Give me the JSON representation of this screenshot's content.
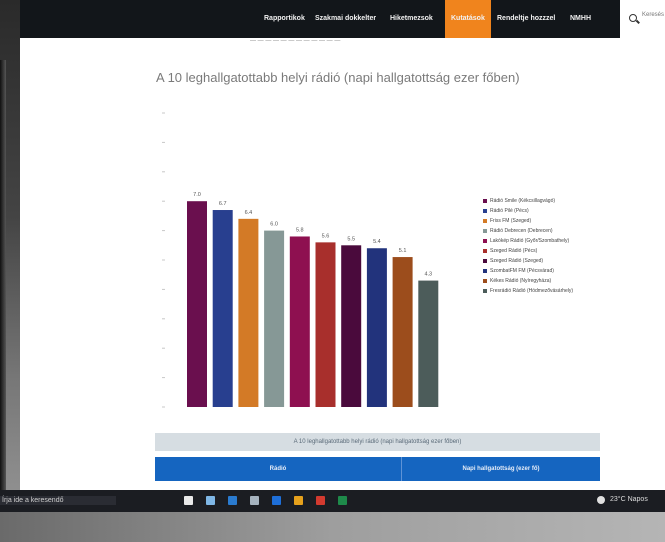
{
  "nav": {
    "items": [
      "Rapportikok",
      "Szakmai dokkelter",
      "Hiketmezsok",
      "Kutatások",
      "Rendeltje hozzzel",
      "NMHH"
    ],
    "active_index": 3,
    "search_placeholder": "Keresés"
  },
  "faded_text": "— — — — — — — — — — — —",
  "page_heading": "A 10 leghallgatottabb helyi rádió (napi hallgatottság ezer főben)",
  "chart_data": {
    "type": "bar",
    "title": "",
    "categories": [
      "Rádió Smile (Kékcsillagvágó)",
      "Rádió Pilé (Pécs)",
      "Friss FM (Szeged)",
      "Rádió Debrecen (Debrecen)",
      "Lakókép Rádió (Győr/Szombathely)",
      "Szeged Rádió (Pécs)",
      "Szeged Rádió (Szeged)",
      "SzombatFM FM (Pécsvárad)",
      "Kékes Rádió (Nyíregyháza)",
      "Fresrádió Rádió (Hódmezővásárhely)"
    ],
    "values": [
      7.0,
      6.7,
      6.4,
      6.0,
      5.8,
      5.6,
      5.5,
      5.4,
      5.1,
      4.3
    ],
    "value_labels": [
      "7.0",
      "6.7",
      "6.4",
      "6.0",
      "5.8",
      "5.6",
      "5.5",
      "5.4",
      "5.1",
      "4.3"
    ],
    "colors": [
      "#6a0f4e",
      "#283f8f",
      "#d37a26",
      "#869896",
      "#8e1050",
      "#a82f2c",
      "#4a0a3c",
      "#22337c",
      "#9c4d1c",
      "#4c5c5a"
    ],
    "ylim": [
      0,
      10
    ],
    "grid": false,
    "legend_position": "right"
  },
  "table": {
    "caption": "A 10 leghallgatottabb helyi rádió (napi hallgatottság ezer főben)",
    "headers": [
      "Rádió",
      "Napi hallgatottság (ezer fő)"
    ]
  },
  "taskbar": {
    "left_text": "Írja ide a keresendő",
    "time_text": "23°C Napos",
    "icon_names": [
      "start-icon",
      "search-icon",
      "edge-icon",
      "files-icon",
      "store-icon",
      "chrome-icon",
      "mail-icon",
      "excel-icon"
    ],
    "icon_colors": [
      "#e9e9e9",
      "#7fb7e6",
      "#2a7bd0",
      "#a6b3bf",
      "#1e6fd9",
      "#e6a11c",
      "#d33a2f",
      "#1e8a4a"
    ]
  }
}
